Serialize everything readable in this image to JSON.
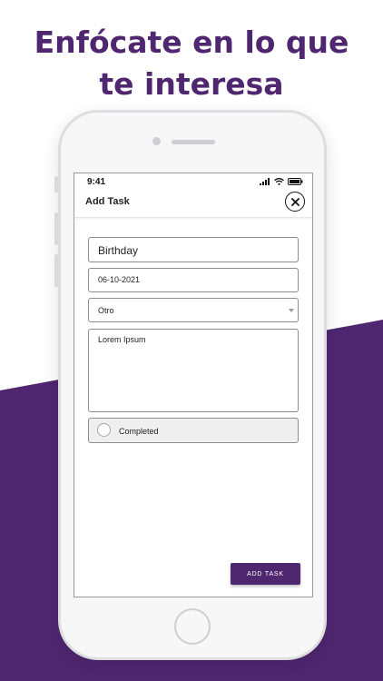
{
  "headline": {
    "line1": "Enfócate en lo que",
    "line2": "te interesa"
  },
  "colors": {
    "brand_purple": "#4f2670",
    "background": "#ffffff"
  },
  "status_bar": {
    "time": "9:41",
    "icons": [
      "signal-icon",
      "wifi-icon",
      "battery-icon"
    ]
  },
  "header": {
    "title": "Add Task",
    "close_icon": "close-icon"
  },
  "form": {
    "title_value": "Birthday",
    "date_value": "06-10-2021",
    "category_value": "Otro",
    "notes_value": "Lorem Ipsum",
    "completed_label": "Completed"
  },
  "actions": {
    "add_task_label": "ADD TASK"
  }
}
